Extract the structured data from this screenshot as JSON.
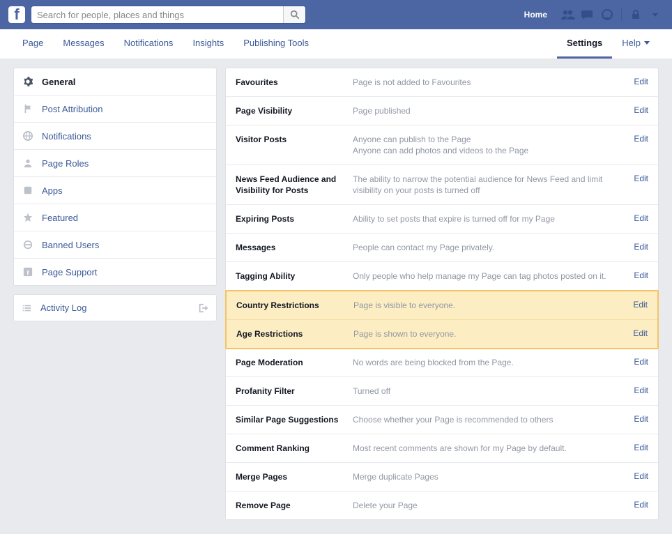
{
  "search": {
    "placeholder": "Search for people, places and things"
  },
  "topnav": {
    "home": "Home"
  },
  "tabs": {
    "items": [
      {
        "label": "Page"
      },
      {
        "label": "Messages"
      },
      {
        "label": "Notifications"
      },
      {
        "label": "Insights"
      },
      {
        "label": "Publishing Tools"
      }
    ],
    "settings": "Settings",
    "help": "Help"
  },
  "sidebar": {
    "items": [
      {
        "label": "General"
      },
      {
        "label": "Post Attribution"
      },
      {
        "label": "Notifications"
      },
      {
        "label": "Page Roles"
      },
      {
        "label": "Apps"
      },
      {
        "label": "Featured"
      },
      {
        "label": "Banned Users"
      },
      {
        "label": "Page Support"
      }
    ],
    "activity": "Activity Log"
  },
  "settings_rows": [
    {
      "label": "Favourites",
      "desc": "Page is not added to Favourites",
      "edit": "Edit"
    },
    {
      "label": "Page Visibility",
      "desc": "Page published",
      "edit": "Edit"
    },
    {
      "label": "Visitor Posts",
      "desc": "Anyone can publish to the Page\nAnyone can add photos and videos to the Page",
      "edit": "Edit"
    },
    {
      "label": "News Feed Audience and Visibility for Posts",
      "desc": "The ability to narrow the potential audience for News Feed and limit visibility on your posts is turned off",
      "edit": "Edit"
    },
    {
      "label": "Expiring Posts",
      "desc": "Ability to set posts that expire is turned off for my Page",
      "edit": "Edit"
    },
    {
      "label": "Messages",
      "desc": "People can contact my Page privately.",
      "edit": "Edit"
    },
    {
      "label": "Tagging Ability",
      "desc": "Only people who help manage my Page can tag photos posted on it.",
      "edit": "Edit"
    },
    {
      "label": "Country Restrictions",
      "desc": "Page is visible to everyone.",
      "edit": "Edit"
    },
    {
      "label": "Age Restrictions",
      "desc": "Page is shown to everyone.",
      "edit": "Edit"
    },
    {
      "label": "Page Moderation",
      "desc": "No words are being blocked from the Page.",
      "edit": "Edit"
    },
    {
      "label": "Profanity Filter",
      "desc": "Turned off",
      "edit": "Edit"
    },
    {
      "label": "Similar Page Suggestions",
      "desc": "Choose whether your Page is recommended to others",
      "edit": "Edit"
    },
    {
      "label": "Comment Ranking",
      "desc": "Most recent comments are shown for my Page by default.",
      "edit": "Edit"
    },
    {
      "label": "Merge Pages",
      "desc": "Merge duplicate Pages",
      "edit": "Edit"
    },
    {
      "label": "Remove Page",
      "desc": "Delete your Page",
      "edit": "Edit"
    }
  ]
}
